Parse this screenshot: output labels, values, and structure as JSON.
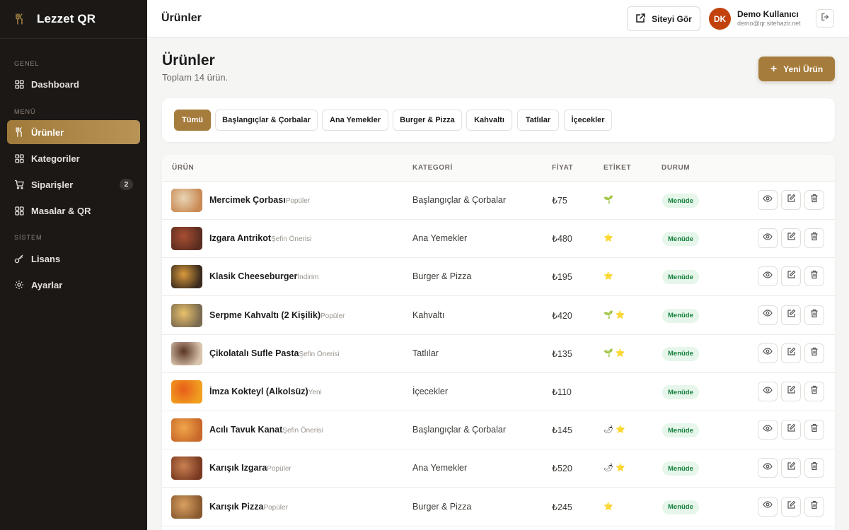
{
  "brand": {
    "name": "Lezzet QR"
  },
  "sidebar": {
    "sections": [
      {
        "label": "GENEL"
      },
      {
        "label": "MENÜ"
      },
      {
        "label": "SİSTEM"
      }
    ],
    "items": [
      {
        "label": "Dashboard",
        "icon": "grid-icon"
      },
      {
        "label": "Ürünler",
        "icon": "utensils-icon",
        "active": true
      },
      {
        "label": "Kategoriler",
        "icon": "grid-icon"
      },
      {
        "label": "Siparişler",
        "icon": "cart-icon",
        "badge": "2"
      },
      {
        "label": "Masalar & QR",
        "icon": "grid-icon"
      },
      {
        "label": "Lisans",
        "icon": "key-icon"
      },
      {
        "label": "Ayarlar",
        "icon": "gear-icon"
      }
    ]
  },
  "header": {
    "title": "Ürünler",
    "site_button": "Siteyi Gör",
    "user": {
      "initials": "DK",
      "name": "Demo Kullanıcı",
      "email": "demo@qr.sitehazir.net"
    }
  },
  "page": {
    "title": "Ürünler",
    "subtitle": "Toplam 14 ürün.",
    "new_button": "Yeni Ürün"
  },
  "filters": [
    "Tümü",
    "Başlangıçlar & Çorbalar",
    "Ana Yemekler",
    "Burger & Pizza",
    "Kahvaltı",
    "Tatlılar",
    "İçecekler"
  ],
  "table": {
    "columns": [
      "ÜRÜN",
      "KATEGORİ",
      "FİYAT",
      "ETİKET",
      "DURUM"
    ],
    "rows": [
      {
        "name": "Mercimek Çorbası",
        "tag": "Popüler",
        "category": "Başlangıçlar & Çorbalar",
        "price": "₺75",
        "labels": [
          "🌱"
        ],
        "status": "Menüde"
      },
      {
        "name": "Izgara Antrikot",
        "tag": "Şefin Önerisi",
        "category": "Ana Yemekler",
        "price": "₺480",
        "labels": [
          "⭐"
        ],
        "status": "Menüde"
      },
      {
        "name": "Klasik Cheeseburger",
        "tag": "İndirim",
        "category": "Burger & Pizza",
        "price": "₺195",
        "labels": [
          "⭐"
        ],
        "status": "Menüde"
      },
      {
        "name": "Serpme Kahvaltı (2 Kişilik)",
        "tag": "Popüler",
        "category": "Kahvaltı",
        "price": "₺420",
        "labels": [
          "🌱",
          "⭐"
        ],
        "status": "Menüde"
      },
      {
        "name": "Çikolatalı Sufle Pasta",
        "tag": "Şefin Önerisi",
        "category": "Tatlılar",
        "price": "₺135",
        "labels": [
          "🌱",
          "⭐"
        ],
        "status": "Menüde"
      },
      {
        "name": "İmza Kokteyl (Alkolsüz)",
        "tag": "Yeni",
        "category": "İçecekler",
        "price": "₺110",
        "labels": [],
        "status": "Menüde"
      },
      {
        "name": "Acılı Tavuk Kanat",
        "tag": "Şefin Önerisi",
        "category": "Başlangıçlar & Çorbalar",
        "price": "₺145",
        "labels": [
          "🌶",
          "⭐"
        ],
        "status": "Menüde"
      },
      {
        "name": "Karışık Izgara",
        "tag": "Popüler",
        "category": "Ana Yemekler",
        "price": "₺520",
        "labels": [
          "🌶",
          "⭐"
        ],
        "status": "Menüde"
      },
      {
        "name": "Karışık Pizza",
        "tag": "Popüler",
        "category": "Burger & Pizza",
        "price": "₺245",
        "labels": [
          "⭐"
        ],
        "status": "Menüde"
      }
    ]
  },
  "colors": {
    "accent": "#a67c3d",
    "sidebar": "#1c1816",
    "status_bg": "#e6f6ea",
    "status_text": "#15803d"
  }
}
